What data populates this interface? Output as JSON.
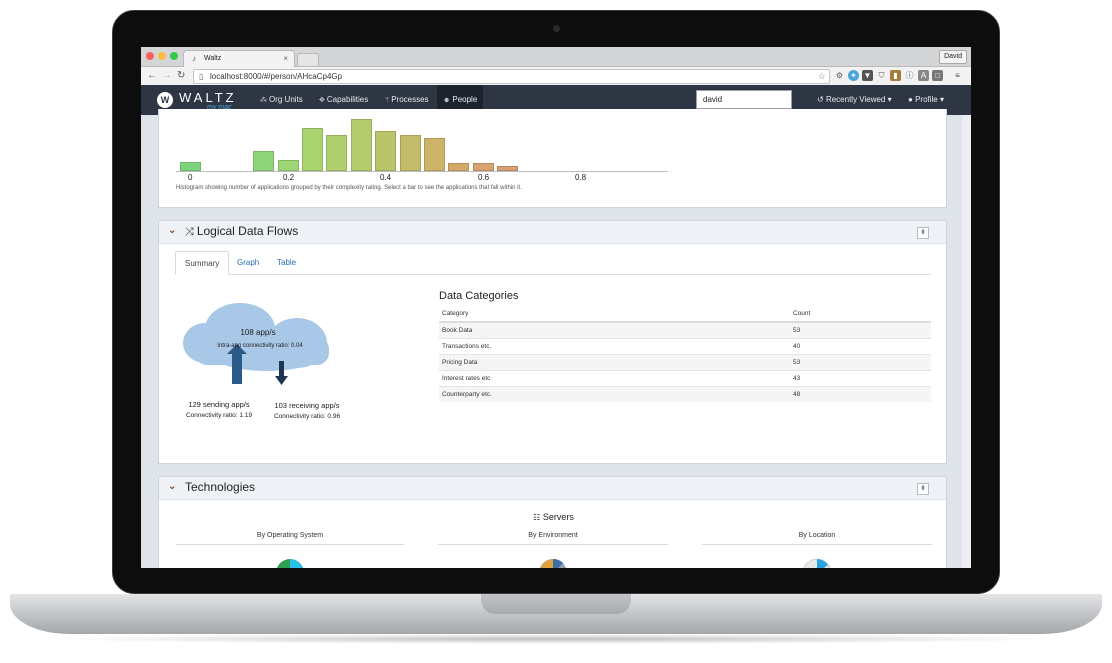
{
  "browser": {
    "tab_title": "Waltz",
    "user_button": "David",
    "url": "localhost:8000/#/person/AHcaCp4Gp"
  },
  "navbar": {
    "logo": "WALTZ",
    "logo_sub": "my mac",
    "links": [
      {
        "label": "Org Units",
        "icon": "sitemap-icon"
      },
      {
        "label": "Capabilities",
        "icon": "puzzle-icon"
      },
      {
        "label": "Processes",
        "icon": "code-fork-icon"
      },
      {
        "label": "People",
        "icon": "users-icon"
      }
    ],
    "search_value": "david",
    "recently_viewed": "Recently Viewed",
    "profile": "Profile"
  },
  "histogram": {
    "tick_labels": [
      "0",
      "0.2",
      "0.4",
      "0.6",
      "0.8"
    ],
    "note": "Histogram showing number of applications grouped by their complexity rating. Select a bar to see the applications that fall within it.",
    "bar_heights_relative": [
      0.17,
      0,
      0,
      0.38,
      0.21,
      0.83,
      0.7,
      1.0,
      0.76,
      0.7,
      0.64,
      0.15,
      0.15,
      0.1
    ],
    "colors": [
      "#7ed47e",
      "#7ed47e",
      "#7ed47e",
      "#8fd478",
      "#9dd474",
      "#a9d470",
      "#b0d06e",
      "#b5cc6d",
      "#bcc46a",
      "#c4bc68",
      "#ceb468",
      "#d4aa6c",
      "#d6a46e",
      "#d8a070"
    ]
  },
  "flows": {
    "title": "Logical Data Flows",
    "tabs": [
      "Summary",
      "Graph",
      "Table"
    ],
    "cloud_title": "108 app/s",
    "cloud_sub": "Intra-app connectivity ratio: 0.04",
    "sending": "129 sending app/s",
    "sending_ratio": "Connectivity ratio: 1.19",
    "receiving": "103 receiving app/s",
    "receiving_ratio": "Connectivity ratio: 0.96",
    "categories_title": "Data Categories",
    "columns": [
      "Category",
      "Count"
    ],
    "rows": [
      [
        "Book Data",
        "53"
      ],
      [
        "Transactions etc.",
        "40"
      ],
      [
        "Pricing Data",
        "53"
      ],
      [
        "Interest rates etc",
        "43"
      ],
      [
        "Counterparty etc.",
        "48"
      ]
    ]
  },
  "technologies": {
    "title": "Technologies",
    "servers": "Servers",
    "groups": [
      "By Operating System",
      "By Environment",
      "By Location"
    ]
  }
}
